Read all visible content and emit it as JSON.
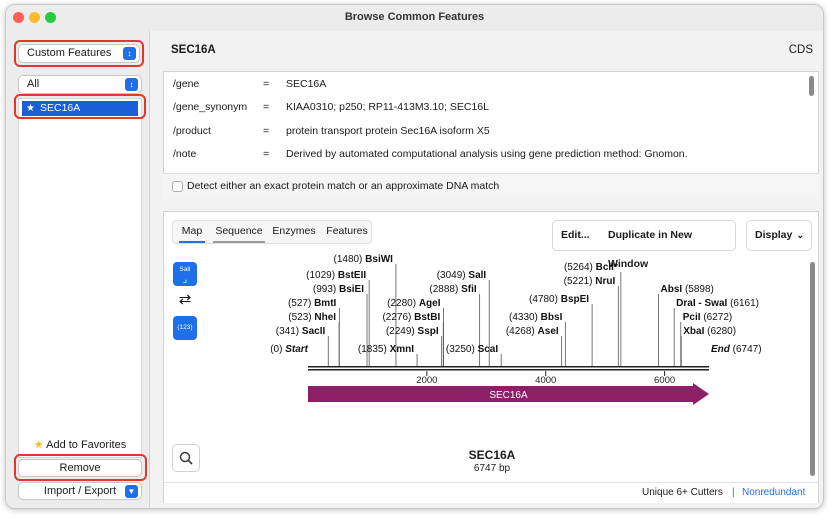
{
  "window": {
    "title": "Browse Common Features"
  },
  "sidebar": {
    "category_select": "Custom Features",
    "filter_select": "All",
    "items": [
      {
        "label": "SEC16A",
        "selected": true
      }
    ],
    "favorites_button": "Add to Favorites",
    "remove_button": "Remove",
    "import_export": "Import / Export"
  },
  "feature": {
    "name": "SEC16A",
    "type": "CDS",
    "qualifiers": [
      {
        "key": "/gene",
        "eq": "=",
        "value": "SEC16A"
      },
      {
        "key": "/gene_synonym",
        "eq": "=",
        "value": "KIAA0310; p250; RP11-413M3.10; SEC16L"
      },
      {
        "key": "/product",
        "eq": "=",
        "value": "protein transport protein Sec16A isoform X5"
      },
      {
        "key": "/note",
        "eq": "=",
        "value": "Derived by automated computational analysis using gene prediction method: Gnomon."
      }
    ],
    "match_checkbox_label": "Detect either an exact protein match or an approximate DNA match"
  },
  "map": {
    "tabs": [
      "Map",
      "Sequence",
      "Enzymes",
      "Features"
    ],
    "active_tab": "Map",
    "edit_button": "Edit...",
    "duplicate_button": "Duplicate in New Window",
    "display_button": "Display",
    "tool_salI_label": "SalI",
    "tool_count_label": "(123)",
    "sequence_name": "SEC16A",
    "sequence_length": "6747 bp",
    "feature_arrow_label": "SEC16A",
    "cutters_label": "Unique 6+ Cutters",
    "separator": "|",
    "nonredundant_label": "Nonredundant",
    "scale_ticks": [
      {
        "pos": 2000,
        "label": "2000"
      },
      {
        "pos": 4000,
        "label": "4000"
      },
      {
        "pos": 6000,
        "label": "6000"
      }
    ],
    "total_length": 6747,
    "sites": [
      {
        "name": "Start",
        "pos": 0,
        "italic": true
      },
      {
        "name": "SacII",
        "pos": 341
      },
      {
        "name": "NheI",
        "pos": 523
      },
      {
        "name": "BmtI",
        "pos": 527
      },
      {
        "name": "BsiEI",
        "pos": 993
      },
      {
        "name": "BstEII",
        "pos": 1029
      },
      {
        "name": "BsiWI",
        "pos": 1480
      },
      {
        "name": "XmnI",
        "pos": 1835
      },
      {
        "name": "SspI",
        "pos": 2249
      },
      {
        "name": "BstBI",
        "pos": 2276
      },
      {
        "name": "AgeI",
        "pos": 2280
      },
      {
        "name": "SfiI",
        "pos": 2888
      },
      {
        "name": "SalI",
        "pos": 3049
      },
      {
        "name": "ScaI",
        "pos": 3250
      },
      {
        "name": "AseI",
        "pos": 4268
      },
      {
        "name": "BbsI",
        "pos": 4330
      },
      {
        "name": "BspEI",
        "pos": 4780
      },
      {
        "name": "NruI",
        "pos": 5221
      },
      {
        "name": "BclI*",
        "pos": 5264
      },
      {
        "name": "AbsI",
        "pos": 5898
      },
      {
        "name": "DraI - SwaI",
        "pos": 6161
      },
      {
        "name": "PciI",
        "pos": 6272
      },
      {
        "name": "XbaI",
        "pos": 6280
      },
      {
        "name": "End",
        "pos": 6747,
        "italic": true
      }
    ]
  }
}
